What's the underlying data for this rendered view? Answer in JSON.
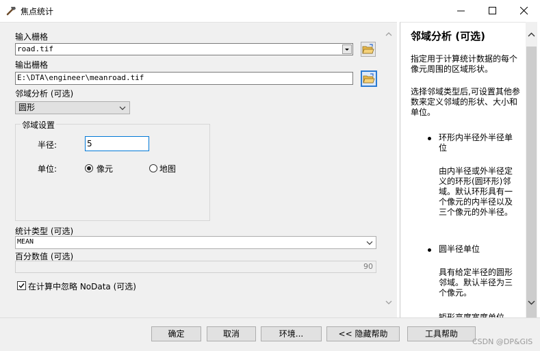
{
  "window": {
    "title": "焦点统计",
    "minimize_icon": "minimize-icon",
    "maximize_icon": "maximize-icon",
    "close_icon": "close-icon"
  },
  "form": {
    "input_raster": {
      "label": "输入栅格",
      "value": "road.tif"
    },
    "output_raster": {
      "label": "输出栅格",
      "value": "E:\\DTA\\engineer\\meanroad.tif"
    },
    "neighborhood": {
      "label": "邻域分析 (可选)",
      "selected": "圆形"
    },
    "neighborhood_settings": {
      "title": "邻域设置",
      "radius_label": "半径:",
      "radius_value": "5",
      "unit_label": "单位:",
      "unit_options": [
        {
          "label": "像元",
          "checked": true
        },
        {
          "label": "地图",
          "checked": false
        }
      ]
    },
    "statistics_type": {
      "label": "统计类型 (可选)",
      "selected": "MEAN"
    },
    "percentile": {
      "label": "百分数值 (可选)",
      "value": "90"
    },
    "ignore_nodata": {
      "label": "在计算中忽略 NoData (可选)",
      "checked": true
    }
  },
  "help": {
    "heading": "邻域分析 (可选)",
    "p1": "指定用于计算统计数据的每个像元周围的区域形状。",
    "p2": "选择邻域类型后,可设置其他参数来定义邻域的形状、大小和单位。",
    "bullet1": "环形内半径外半径单位",
    "bullet1_desc": "由内半径或外半径定义的环形(圆环形)邻域。默认环形具有一个像元的内半径以及三个像元的外半径。",
    "bullet2": "圆半径单位",
    "bullet2_desc": "具有给定半径的圆形邻域。默认半径为三个像元。",
    "bullet3_partial": "矩形高度宽度单位"
  },
  "buttons": {
    "ok": "确定",
    "cancel": "取消",
    "environments": "环境...",
    "hide_help": "<< 隐藏帮助",
    "tool_help": "工具帮助"
  },
  "watermark": "CSDN @DP&GIS"
}
